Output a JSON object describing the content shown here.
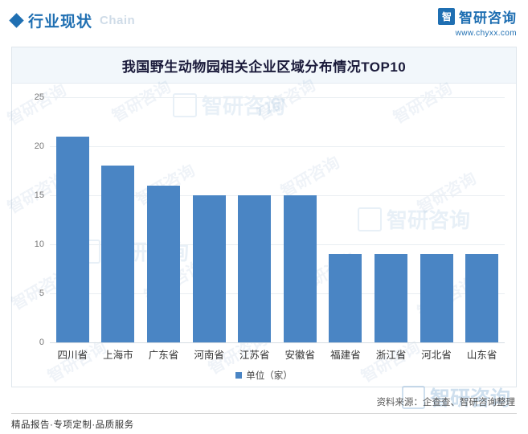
{
  "header": {
    "title": "行业现状",
    "subtitle": "Chain",
    "brand_logo_text": "智",
    "brand_name": "智研咨询",
    "brand_url": "www.chyxx.com"
  },
  "card": {
    "title": "我国野生动物园相关企业区域分布情况TOP10"
  },
  "watermarks": {
    "text": "智研咨询",
    "logo_text": "智"
  },
  "footer": {
    "source": "资料来源：企查查、智研咨询整理",
    "services": "精品报告·专项定制·品质服务",
    "brand": "智研咨询"
  },
  "chart_data": {
    "type": "bar",
    "title": "我国野生动物园相关企业区域分布情况TOP10",
    "xlabel": "",
    "ylabel": "",
    "ylim": [
      0,
      25
    ],
    "yticks": [
      0,
      5,
      10,
      15,
      20,
      25
    ],
    "grid": true,
    "legend": [
      "单位（家）"
    ],
    "legend_position": "bottom",
    "bar_color": "#4a85c4",
    "categories": [
      "四川省",
      "上海市",
      "广东省",
      "河南省",
      "江苏省",
      "安徽省",
      "福建省",
      "浙江省",
      "河北省",
      "山东省"
    ],
    "values": [
      21,
      18,
      16,
      15,
      15,
      15,
      9,
      9,
      9,
      9
    ]
  }
}
